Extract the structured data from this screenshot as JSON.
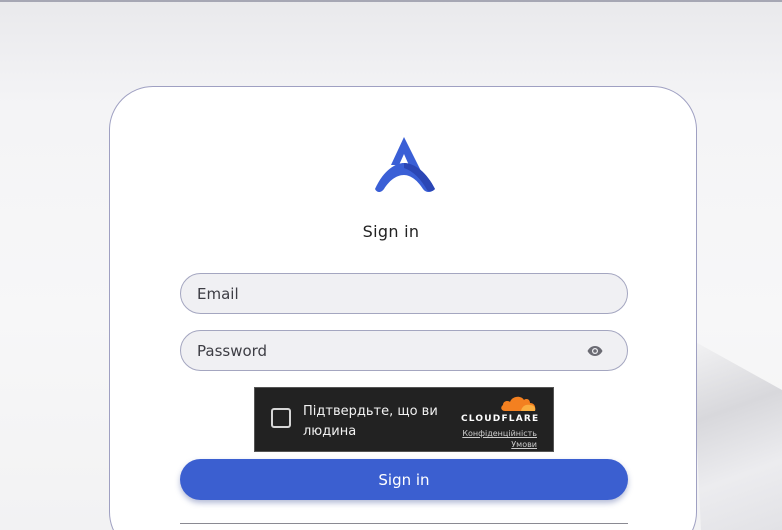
{
  "auth": {
    "title": "Sign in",
    "email_placeholder": "Email",
    "password_placeholder": "Password",
    "submit_label": "Sign in"
  },
  "captcha": {
    "label": "Підтвердьте, що ви людина",
    "brand": "CLOUDFLARE",
    "privacy_link": "Конфіденційність",
    "terms_link": "Умови"
  },
  "icons": {
    "logo": "app-logo-icon",
    "password_toggle": "eye-icon",
    "captcha_brand": "cloudflare-cloud-icon"
  },
  "colors": {
    "accent": "#3b5fd0",
    "logo": "#3a5fd6",
    "captcha_bg": "#222222",
    "cloudflare_orange": "#f38020"
  }
}
